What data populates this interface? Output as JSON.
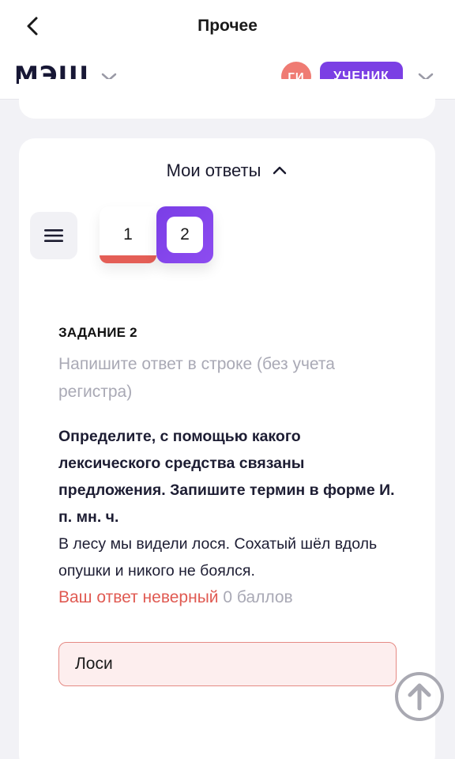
{
  "topbar": {
    "title": "Прочее",
    "back_icon": "chevron-left-icon"
  },
  "appbar": {
    "logo": "МЭШ",
    "avatar_initials": "ГИ",
    "role": "УЧЕНИК",
    "colors": {
      "avatar": "#ef7b73",
      "role_badge": "#7b3fe4"
    }
  },
  "answers": {
    "toggle_label": "Мои ответы",
    "tabs": [
      {
        "label": "1",
        "status": "wrong"
      },
      {
        "label": "2",
        "status": "selected"
      }
    ]
  },
  "task": {
    "title": "ЗАДАНИЕ 2",
    "hint": "Напишите ответ в строке (без учета регистра)",
    "question": "Определите, с помощью какого лексического средства связаны предложения. Запишите термин в форме И. п. мн. ч.",
    "text": "В лесу мы видели лося. Сохатый шёл вдоль опушки и никого не боялся.",
    "result_label": "Ваш ответ неверный",
    "points_label": "0 баллов",
    "answer_value": "Лоси"
  },
  "colors": {
    "accent": "#7b3fe4",
    "error": "#e05a52",
    "muted": "#a9a9b5"
  }
}
